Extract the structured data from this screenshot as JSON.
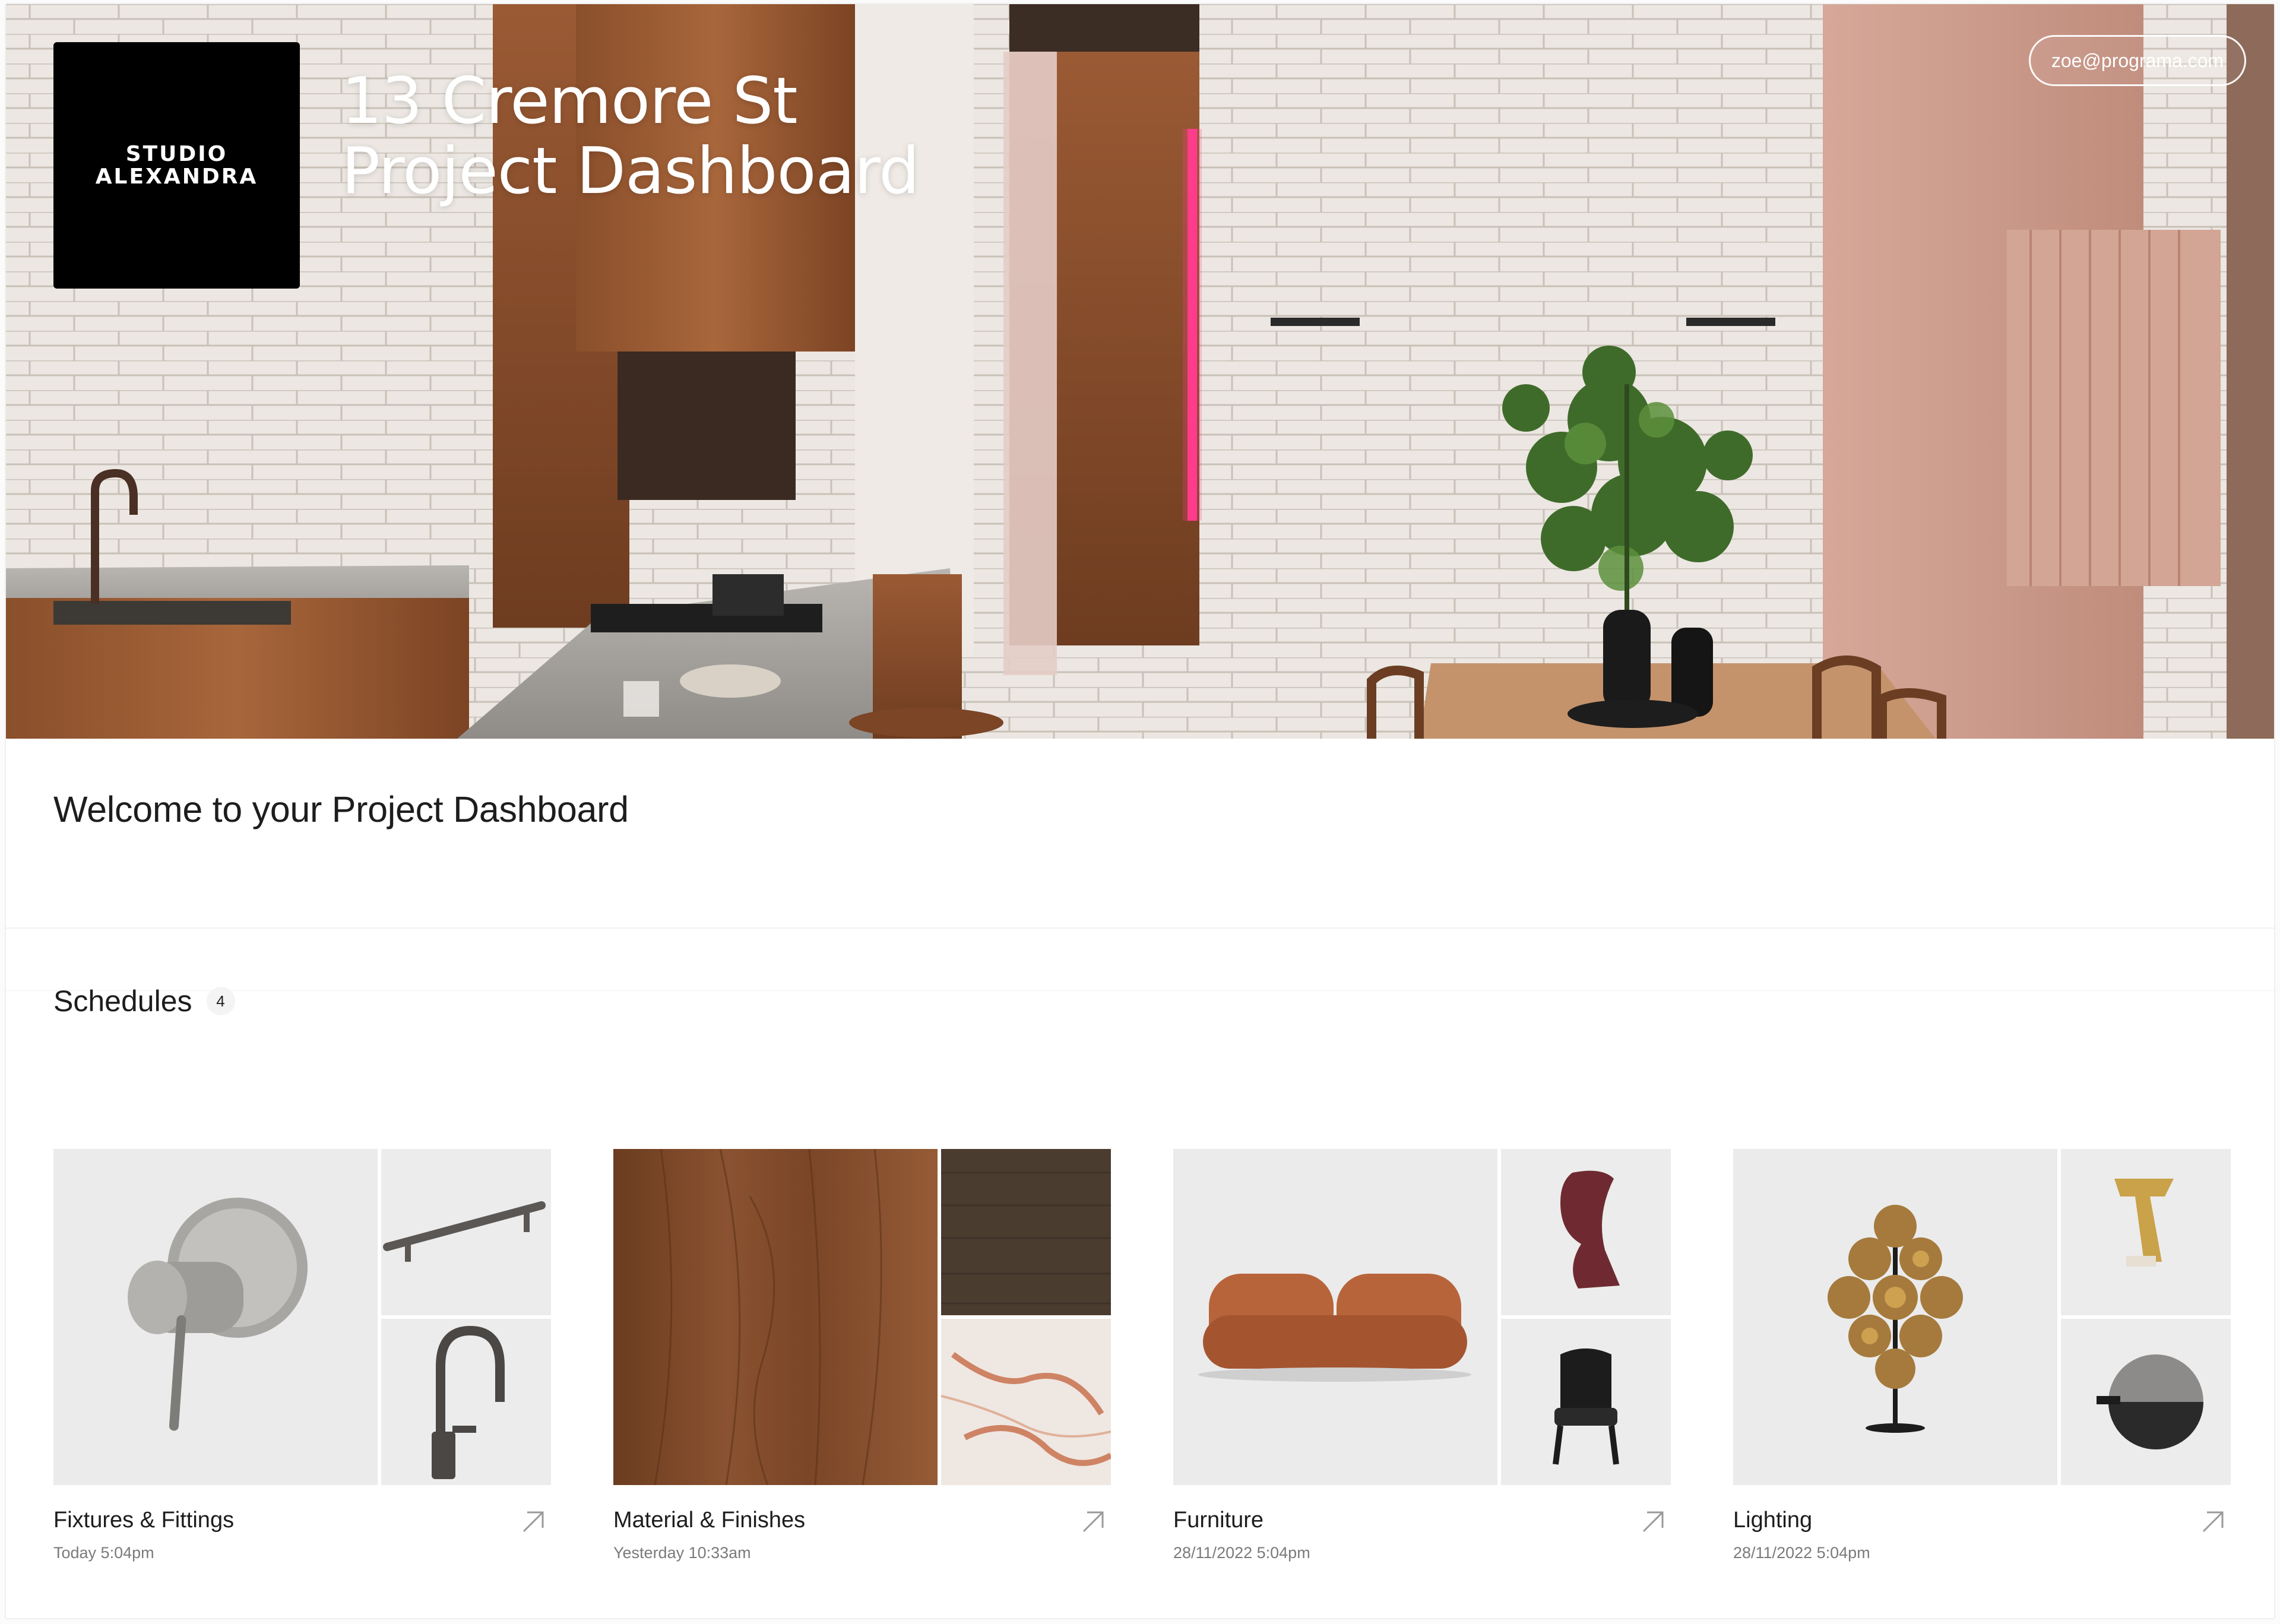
{
  "header": {
    "brand_line1": "STUDIO",
    "brand_line2": "ALEXANDRA",
    "title_line1": "13 Cremore St",
    "title_line2": "Project Dashboard",
    "user_email": "zoe@programa.com"
  },
  "welcome": {
    "heading": "Welcome to your Project Dashboard"
  },
  "schedules": {
    "title": "Schedules",
    "count": "4",
    "cards": [
      {
        "title": "Fixtures & Fittings",
        "updated": "Today 5:04pm",
        "icon": "arrow-up-right-icon"
      },
      {
        "title": "Material & Finishes",
        "updated": "Yesterday 10:33am",
        "icon": "arrow-up-right-icon"
      },
      {
        "title": "Furniture",
        "updated": "28/11/2022 5:04pm",
        "icon": "arrow-up-right-icon"
      },
      {
        "title": "Lighting",
        "updated": "28/11/2022 5:04pm",
        "icon": "arrow-up-right-icon"
      }
    ]
  },
  "colors": {
    "accent_black": "#000000",
    "text_primary": "#1d1d1d",
    "text_muted": "#7a7a7a"
  }
}
